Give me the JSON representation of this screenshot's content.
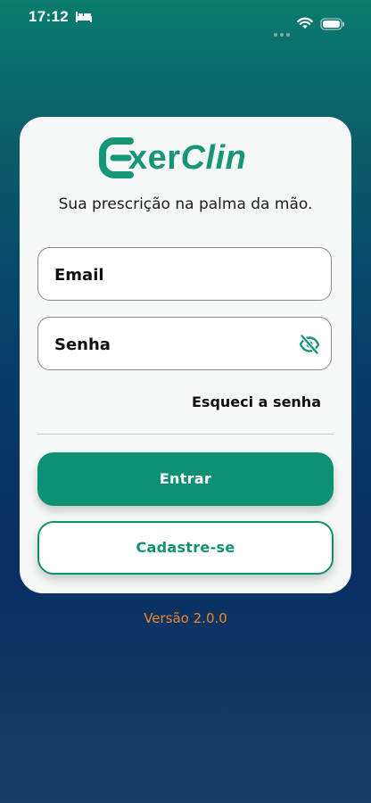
{
  "status_bar": {
    "time": "17:12",
    "icons": [
      "bed-icon",
      "dots-icon",
      "wifi-icon",
      "battery-icon"
    ]
  },
  "logo": {
    "text_part1": "xer",
    "text_part2": "Clin",
    "color": "#149677"
  },
  "tagline": "Sua prescrição na palma da mão.",
  "login_form": {
    "email_placeholder": "Email",
    "password_placeholder": "Senha",
    "password_toggle_icon": "eye-off-icon",
    "forgot_password_label": "Esqueci a senha",
    "submit_label": "Entrar",
    "register_label": "Cadastre-se"
  },
  "version": "Versão 2.0.0",
  "colors": {
    "accent": "#0e9173",
    "version_text": "#e58a2c"
  }
}
